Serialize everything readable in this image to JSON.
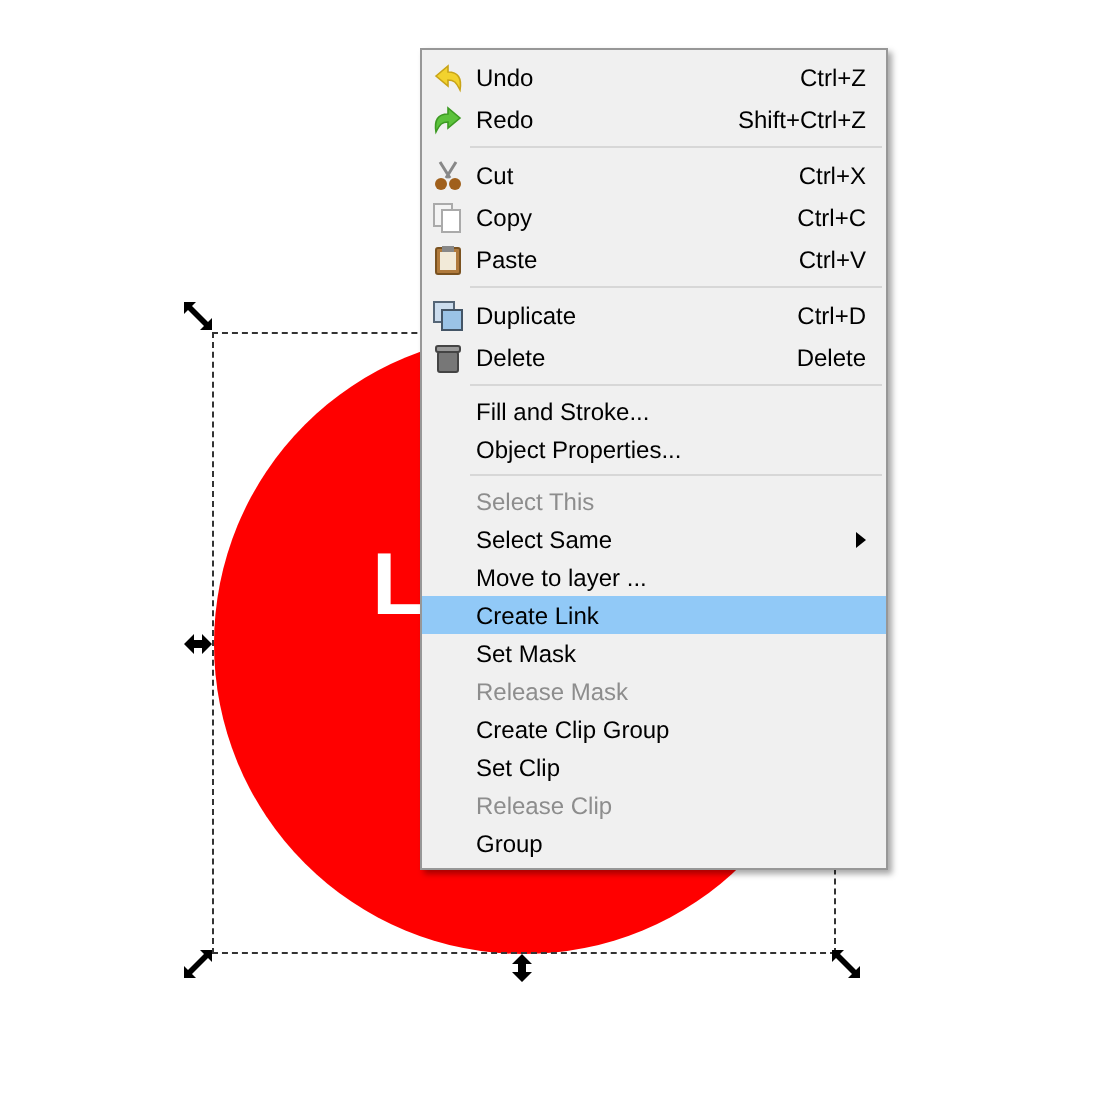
{
  "canvas": {
    "shape_text": [
      "L"
    ]
  },
  "context_menu": {
    "sections": [
      {
        "items": [
          {
            "label": "Undo",
            "shortcut": "Ctrl+Z",
            "disabled": false,
            "selected": false
          },
          {
            "label": "Redo",
            "shortcut": "Shift+Ctrl+Z",
            "disabled": false,
            "selected": false
          }
        ]
      },
      {
        "items": [
          {
            "label": "Cut",
            "shortcut": "Ctrl+X",
            "disabled": false,
            "selected": false
          },
          {
            "label": "Copy",
            "shortcut": "Ctrl+C",
            "disabled": false,
            "selected": false
          },
          {
            "label": "Paste",
            "shortcut": "Ctrl+V",
            "disabled": false,
            "selected": false
          }
        ]
      },
      {
        "items": [
          {
            "label": "Duplicate",
            "shortcut": "Ctrl+D",
            "disabled": false,
            "selected": false
          },
          {
            "label": "Delete",
            "shortcut": "Delete",
            "disabled": false,
            "selected": false
          }
        ]
      },
      {
        "items": [
          {
            "label": "Fill and Stroke...",
            "disabled": false,
            "selected": false
          },
          {
            "label": "Object Properties...",
            "disabled": false,
            "selected": false
          }
        ]
      },
      {
        "items": [
          {
            "label": "Select This",
            "disabled": true,
            "selected": false
          },
          {
            "label": "Select Same",
            "disabled": false,
            "selected": false,
            "submenu": true
          },
          {
            "label": "Move to layer ...",
            "disabled": false,
            "selected": false
          },
          {
            "label": "Create Link",
            "disabled": false,
            "selected": true
          },
          {
            "label": "Set Mask",
            "disabled": false,
            "selected": false
          },
          {
            "label": "Release Mask",
            "disabled": true,
            "selected": false
          },
          {
            "label": "Create Clip Group",
            "disabled": false,
            "selected": false
          },
          {
            "label": "Set Clip",
            "disabled": false,
            "selected": false
          },
          {
            "label": "Release Clip",
            "disabled": true,
            "selected": false
          },
          {
            "label": "Group",
            "disabled": false,
            "selected": false
          }
        ]
      }
    ]
  }
}
